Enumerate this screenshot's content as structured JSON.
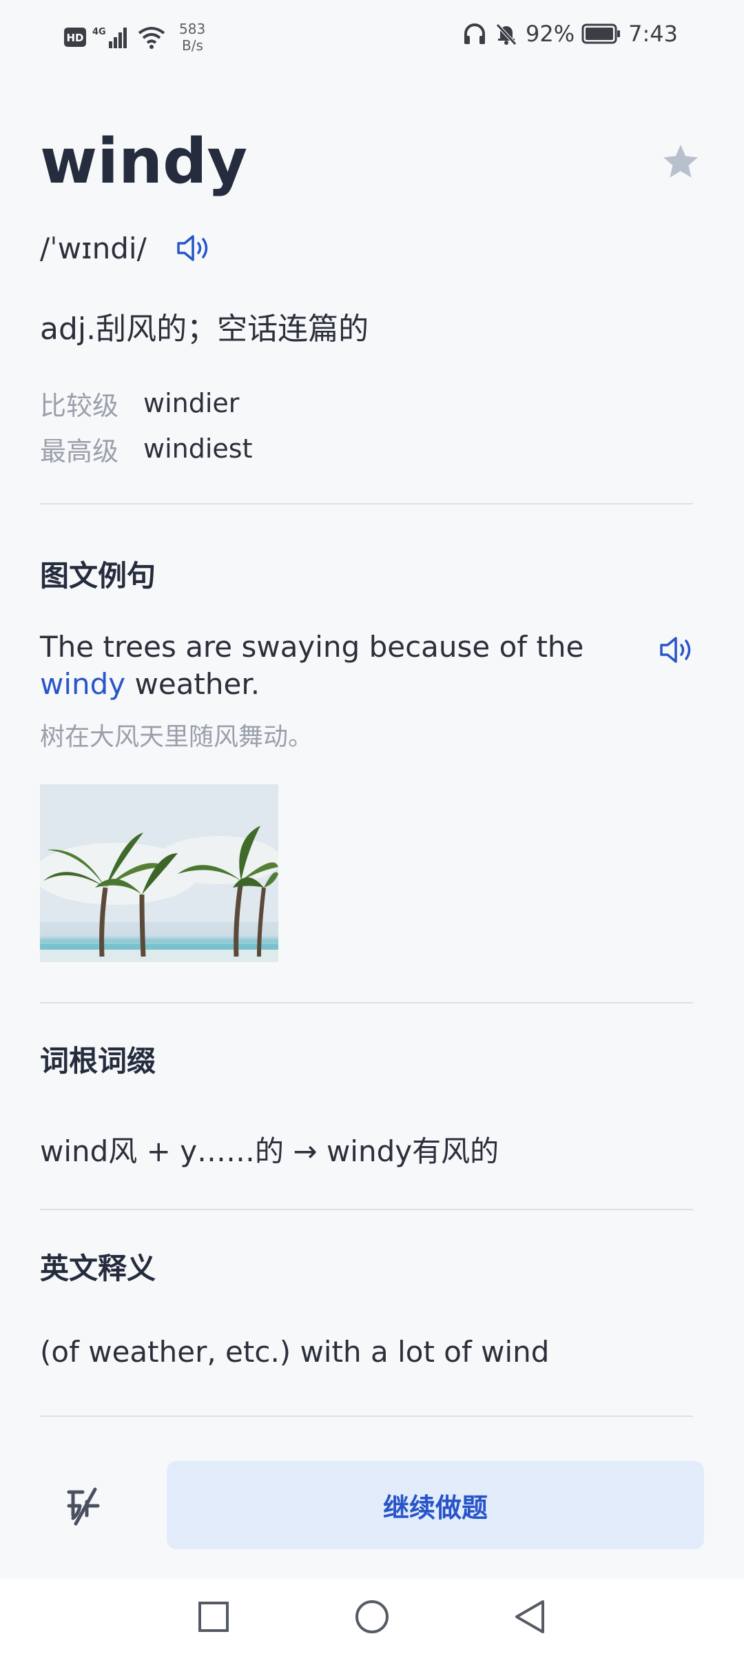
{
  "status_bar": {
    "hd_badge": "HD",
    "signal_label": "4G",
    "net_speed_value": "583",
    "net_speed_unit": "B/s",
    "battery": "92%",
    "time": "7:43",
    "icons": [
      "hd-icon",
      "signal-icon",
      "wifi-icon",
      "headphones-icon",
      "bell-muted-icon",
      "battery-icon"
    ]
  },
  "word": {
    "headword": "windy",
    "phonetic": "/ˈwɪndi/",
    "definition": "adj.刮风的；空话连篇的",
    "forms": [
      {
        "label": "比较级",
        "value": "windier"
      },
      {
        "label": "最高级",
        "value": "windiest"
      }
    ]
  },
  "sections": {
    "example_title": "图文例句",
    "example": {
      "en_before": "The trees are swaying because of the ",
      "en_highlight": "windy",
      "en_after": " weather.",
      "zh": "树在大风天里随风舞动。"
    },
    "etymology_title": "词根词缀",
    "etymology_text": "wind风 + y……的 → windy有风的",
    "english_def_title": "英文释义",
    "english_def_text": "(of weather, etc.) with a lot of wind"
  },
  "actions": {
    "continue_label": "继续做题"
  },
  "colors": {
    "accent": "#2856c8",
    "button_bg": "#e2ecfb",
    "muted_text": "#9aa0aa",
    "star": "#b7c0cc"
  }
}
